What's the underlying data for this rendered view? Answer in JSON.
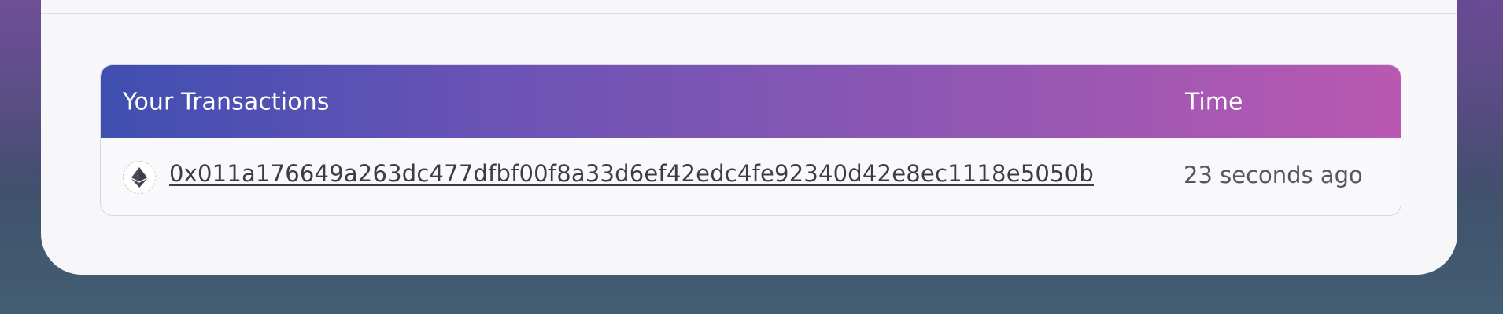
{
  "transactions_table": {
    "header": {
      "title": "Your Transactions",
      "time_label": "Time"
    },
    "rows": [
      {
        "icon": "ethereum-icon",
        "hash": "0x011a176649a263dc477dfbf00f8a33d6ef42edc4fe92340d42e8ec1118e5050b",
        "time": "23 seconds ago"
      }
    ]
  },
  "colors": {
    "header_gradient_start": "#3f4fb1",
    "header_gradient_end": "#b958b1",
    "card_background": "#f7f7f9"
  }
}
